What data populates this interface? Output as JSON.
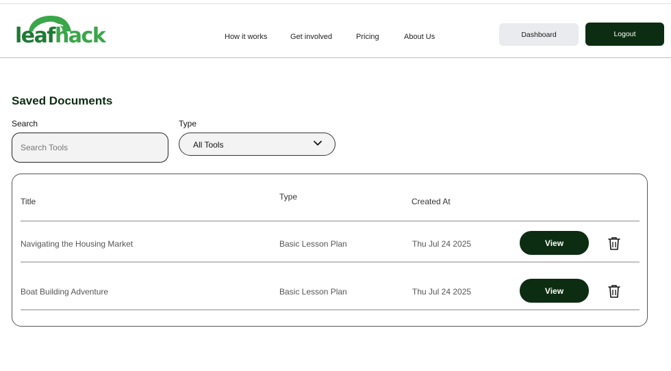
{
  "brand": {
    "part1": "leaf",
    "part2": "hack",
    "icon": "leaf-icon"
  },
  "nav": {
    "links": [
      "How it works",
      "Get involved",
      "Pricing",
      "About Us"
    ],
    "dashboard_label": "Dashboard",
    "logout_label": "Logout"
  },
  "page": {
    "title": "Saved Documents"
  },
  "filters": {
    "search_label": "Search",
    "search_placeholder": "Search Tools",
    "type_label": "Type",
    "type_value": "All Tools"
  },
  "table": {
    "headers": {
      "title": "Title",
      "type": "Type",
      "created": "Created At"
    },
    "rows": [
      {
        "title": "Navigating the Housing Market",
        "type": "Basic Lesson Plan",
        "created": "Thu Jul 24 2025",
        "action": "View"
      },
      {
        "title": "Boat Building Adventure",
        "type": "Basic Lesson Plan",
        "created": "Thu Jul 24 2025",
        "action": "View"
      }
    ]
  },
  "colors": {
    "primary": "#0c2d11",
    "brand_dark": "#1e7a33",
    "brand_light": "#3aa64a",
    "surface": "#f3f3f3"
  }
}
